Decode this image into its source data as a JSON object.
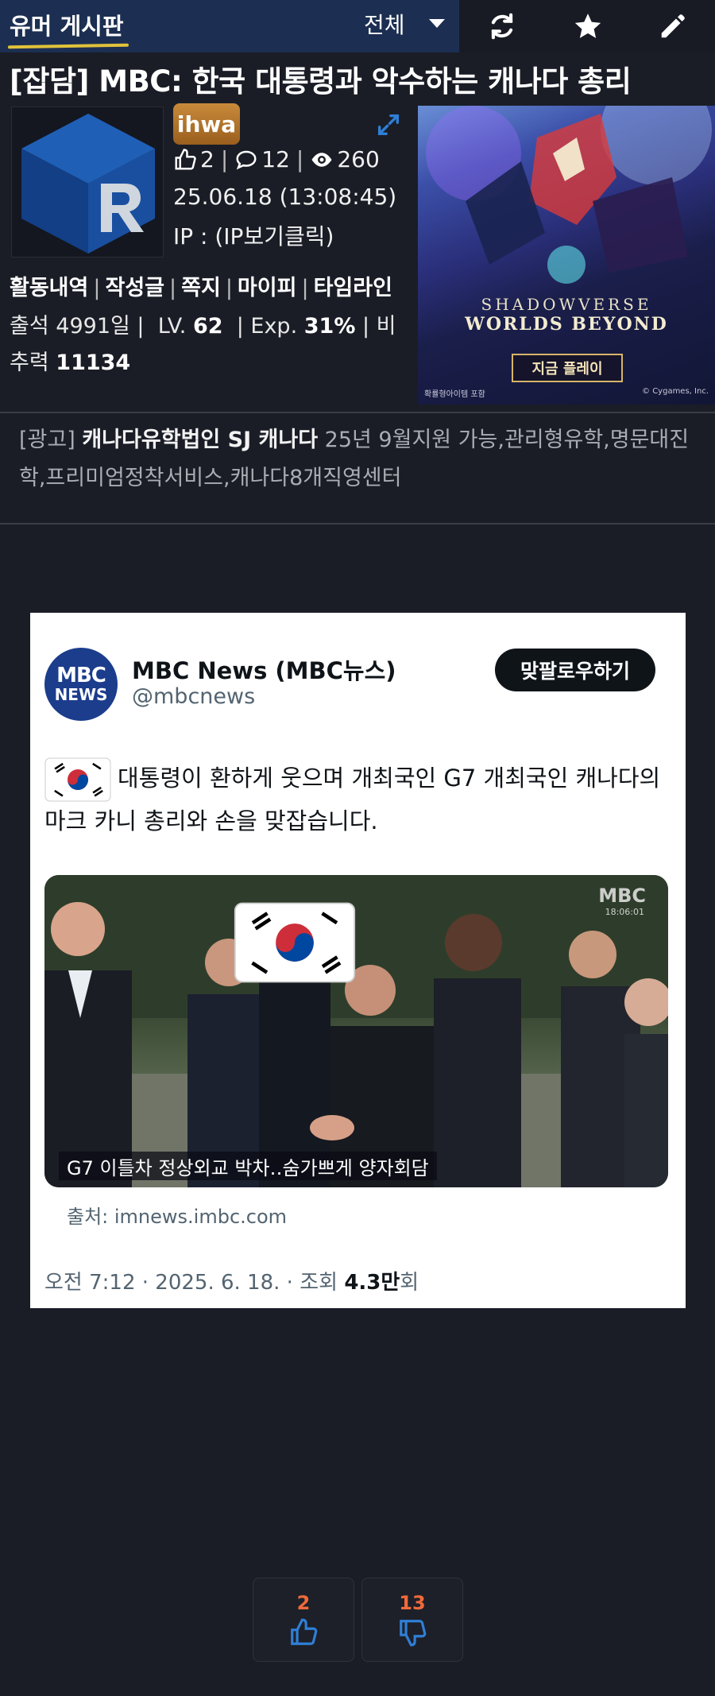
{
  "topbar": {
    "board_title": "유머 게시판",
    "filter": "전체",
    "icons": [
      "refresh-icon",
      "star-icon",
      "pencil-icon"
    ]
  },
  "post": {
    "title": "[잡담] MBC: 한국 대통령과 악수하는 캐나다 총리",
    "author_level": "ihwa",
    "likes": "2",
    "comments": "12",
    "views": "260",
    "date": "25.06.18 (13:08:45)",
    "ip_label": "IP : (IP보기클릭)"
  },
  "activity": [
    "활동내역",
    "작성글",
    "쪽지",
    "마이피",
    "타임라인"
  ],
  "stats": {
    "attendance_label": "출석",
    "attendance_value": "4991일",
    "level_label": "LV.",
    "level_value": "62",
    "exp_label": "Exp.",
    "exp_value": "31%",
    "ratio_label": "비추력",
    "ratio_value": "11134"
  },
  "ad_banner": {
    "logo_line1": "SHADOWVERSE",
    "logo_line2": "WORLDS BEYOND",
    "play_button": "지금 플레이",
    "note": "확률형아이템 포함",
    "copyright": "© Cygames, Inc."
  },
  "text_ad": {
    "prefix": "[광고]",
    "sponsor": "캐나다유학법인 SJ 캐나다",
    "body": "25년 9월지원 가능,관리형유학,명문대진학,프리미엄정착서비스,캐나다8개직영센터"
  },
  "tweet": {
    "avatar_line1": "MBC",
    "avatar_line2": "NEWS",
    "name": "MBC News (MBC뉴스)",
    "handle": "@mbcnews",
    "follow_button": "맞팔로우하기",
    "text": "대통령이 환하게 웃으며 개최국인 G7 개최국인 캐나다의 마크 카니 총리와 손을 맞잡습니다.",
    "media_watermark": "MBC",
    "media_watermark_sub": "18:06:01",
    "media_caption": "G7 이틀차 정상외교 박차‥숨가쁘게 양자회담",
    "source": "출처: imnews.imbc.com",
    "footer_prefix": "오전 7:12 · 2025. 6. 18. · 조회 ",
    "footer_views": "4.3만",
    "footer_suffix": "회"
  },
  "votes": {
    "up": "2",
    "down": "13"
  },
  "colors": {
    "page_bg": "#1a1d26",
    "topbar_select": "#1c2f52",
    "vote_count": "#f06a3a",
    "vote_icon": "#2f7fd6"
  }
}
